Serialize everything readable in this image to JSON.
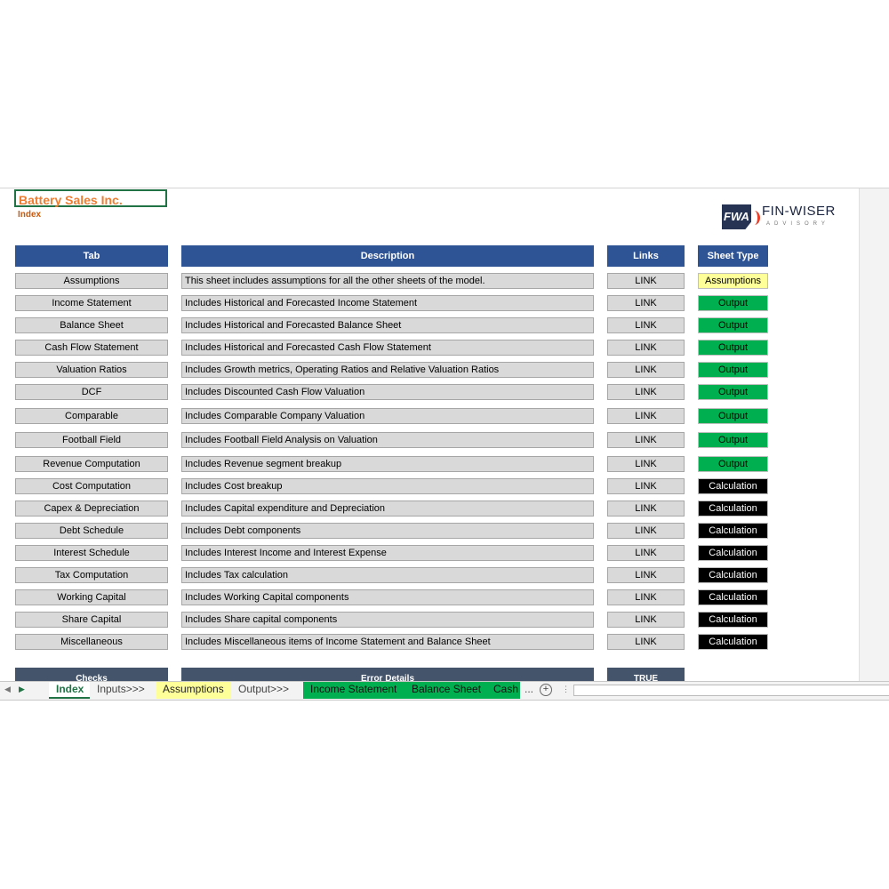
{
  "header": {
    "title": "Battery Sales Inc.",
    "subtitle": "Index"
  },
  "logo": {
    "mark": "FWA",
    "name": "FIN-WISER",
    "tagline": "ADVISORY"
  },
  "columns": {
    "tab": "Tab",
    "description": "Description",
    "links": "Links",
    "sheet_type": "Sheet Type"
  },
  "rows": [
    {
      "tab": "Assumptions",
      "desc": "This sheet includes assumptions for all the other sheets of the model.",
      "link": "LINK",
      "type": "Assumptions"
    },
    {
      "tab": "Income Statement",
      "desc": "Includes Historical and Forecasted Income Statement",
      "link": "LINK",
      "type": "Output"
    },
    {
      "tab": "Balance Sheet",
      "desc": "Includes Historical and Forecasted Balance Sheet",
      "link": "LINK",
      "type": "Output"
    },
    {
      "tab": "Cash Flow Statement",
      "desc": "Includes Historical and Forecasted Cash Flow Statement",
      "link": "LINK",
      "type": "Output"
    },
    {
      "tab": "Valuation Ratios",
      "desc": "Includes Growth metrics, Operating Ratios and Relative Valuation Ratios",
      "link": "LINK",
      "type": "Output"
    },
    {
      "tab": "DCF",
      "desc": "Includes Discounted Cash Flow Valuation",
      "link": "LINK",
      "type": "Output"
    },
    {
      "tab": "Comparable",
      "desc": "Includes Comparable Company Valuation",
      "link": "LINK",
      "type": "Output"
    },
    {
      "tab": "Football Field",
      "desc": "Includes Football Field Analysis on Valuation",
      "link": "LINK",
      "type": "Output"
    },
    {
      "tab": "Revenue Computation",
      "desc": "Includes Revenue segment breakup",
      "link": "LINK",
      "type": "Output"
    },
    {
      "tab": "Cost Computation",
      "desc": "Includes Cost breakup",
      "link": "LINK",
      "type": "Calculation"
    },
    {
      "tab": "Capex & Depreciation",
      "desc": "Includes Capital expenditure and Depreciation",
      "link": "LINK",
      "type": "Calculation"
    },
    {
      "tab": "Debt Schedule",
      "desc": "Includes Debt components",
      "link": "LINK",
      "type": "Calculation"
    },
    {
      "tab": "Interest Schedule",
      "desc": "Includes Interest Income and Interest Expense",
      "link": "LINK",
      "type": "Calculation"
    },
    {
      "tab": "Tax Computation",
      "desc": "Includes Tax calculation",
      "link": "LINK",
      "type": "Calculation"
    },
    {
      "tab": "Working Capital",
      "desc": "Includes Working Capital components",
      "link": "LINK",
      "type": "Calculation"
    },
    {
      "tab": "Share Capital",
      "desc": "Includes Share capital components",
      "link": "LINK",
      "type": "Calculation"
    },
    {
      "tab": "Miscellaneous",
      "desc": "Includes Miscellaneous items of Income Statement and Balance Sheet",
      "link": "LINK",
      "type": "Calculation"
    }
  ],
  "checks": {
    "checks": "Checks",
    "error_details": "Error Details",
    "status": "TRUE"
  },
  "sheet_tabs": [
    {
      "label": "Index",
      "style": "active"
    },
    {
      "label": "Inputs>>>",
      "style": "plain"
    },
    {
      "label": "Assumptions",
      "style": "yellow"
    },
    {
      "label": "Output>>>",
      "style": "plain"
    },
    {
      "label": "Income Statement",
      "style": "green"
    },
    {
      "label": "Balance Sheet",
      "style": "green"
    },
    {
      "label": "Cash",
      "style": "green"
    }
  ],
  "tab_overflow": "...",
  "colors": {
    "header_blue": "#2f5496",
    "output_green": "#00b050",
    "assumption_yellow": "#ffff99",
    "title_orange": "#ed7d31"
  }
}
